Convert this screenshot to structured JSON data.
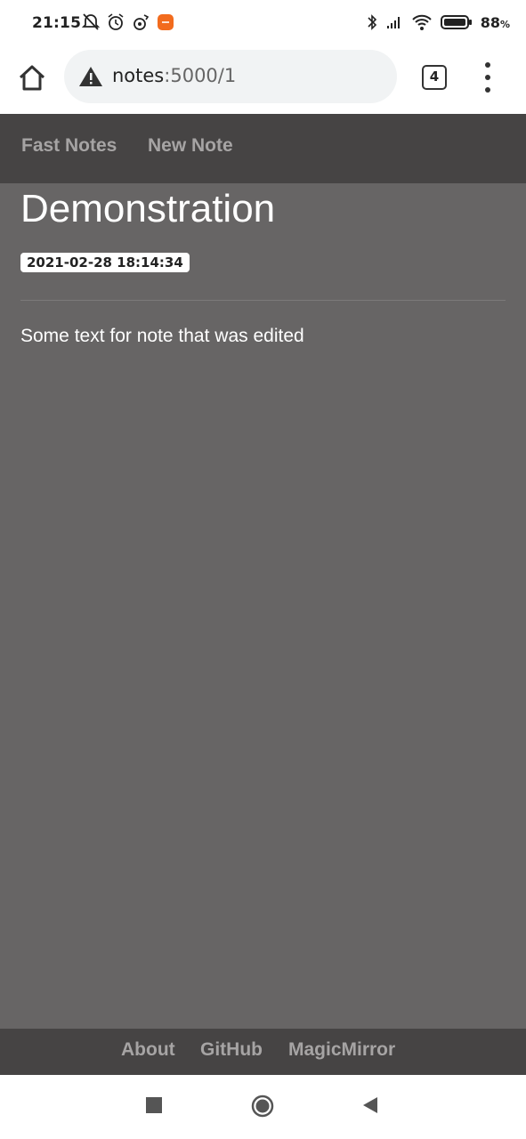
{
  "status_bar": {
    "time": "21:15",
    "battery_percent": "88",
    "battery_unit": "%",
    "icons_left": [
      "mute-alarm-icon",
      "alarm-icon",
      "media-icon",
      "app-notification-icon"
    ],
    "icons_right": [
      "bluetooth-icon",
      "signal-icon",
      "wifi-icon",
      "battery-icon"
    ]
  },
  "browser": {
    "url_host": "notes",
    "url_path": ":5000/1",
    "tab_count": "4"
  },
  "nav": {
    "brand": "Fast Notes",
    "new_note": "New Note"
  },
  "note": {
    "title": "Demonstration",
    "timestamp": "2021-02-28 18:14:34",
    "body": "Some text for note that was edited"
  },
  "footer": {
    "about": "About",
    "github": "GitHub",
    "magicmirror": "MagicMirror"
  },
  "colors": {
    "nav_bg": "#464444",
    "main_bg": "#676565",
    "link": "#a6a4a4",
    "app_icon": "#f26b1d"
  }
}
